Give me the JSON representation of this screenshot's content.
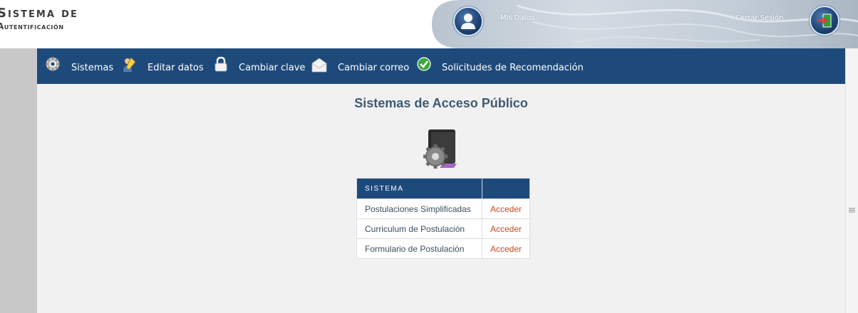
{
  "header": {
    "logo_line1": "Sistema de",
    "logo_line2": "Autentificación",
    "mis_datos": "Mis Datos",
    "cerrar_sesion": "Cerrar Sesión"
  },
  "nav": {
    "items": [
      {
        "label": "Sistemas",
        "icon": "gear-icon"
      },
      {
        "label": "Editar datos",
        "icon": "pencil-user-icon"
      },
      {
        "label": "Cambiar clave",
        "icon": "lock-icon"
      },
      {
        "label": "Cambiar correo",
        "icon": "envelope-icon"
      },
      {
        "label": "Solicitudes de Recomendación",
        "icon": "checkmark-icon"
      }
    ]
  },
  "main": {
    "title": "Sistemas de Acceso Público",
    "table": {
      "header": [
        "SISTEMA",
        ""
      ],
      "rows": [
        {
          "name": "Postulaciones Simplificadas",
          "action": "Acceder"
        },
        {
          "name": "Curriculum de Postulación",
          "action": "Acceder"
        },
        {
          "name": "Formulario de Postulación",
          "action": "Acceder"
        }
      ]
    }
  },
  "colors": {
    "nav_bg": "#1e4a7b",
    "link_accent": "#c64a25",
    "title": "#3f5a70",
    "content_bg": "#f1f1f1"
  }
}
